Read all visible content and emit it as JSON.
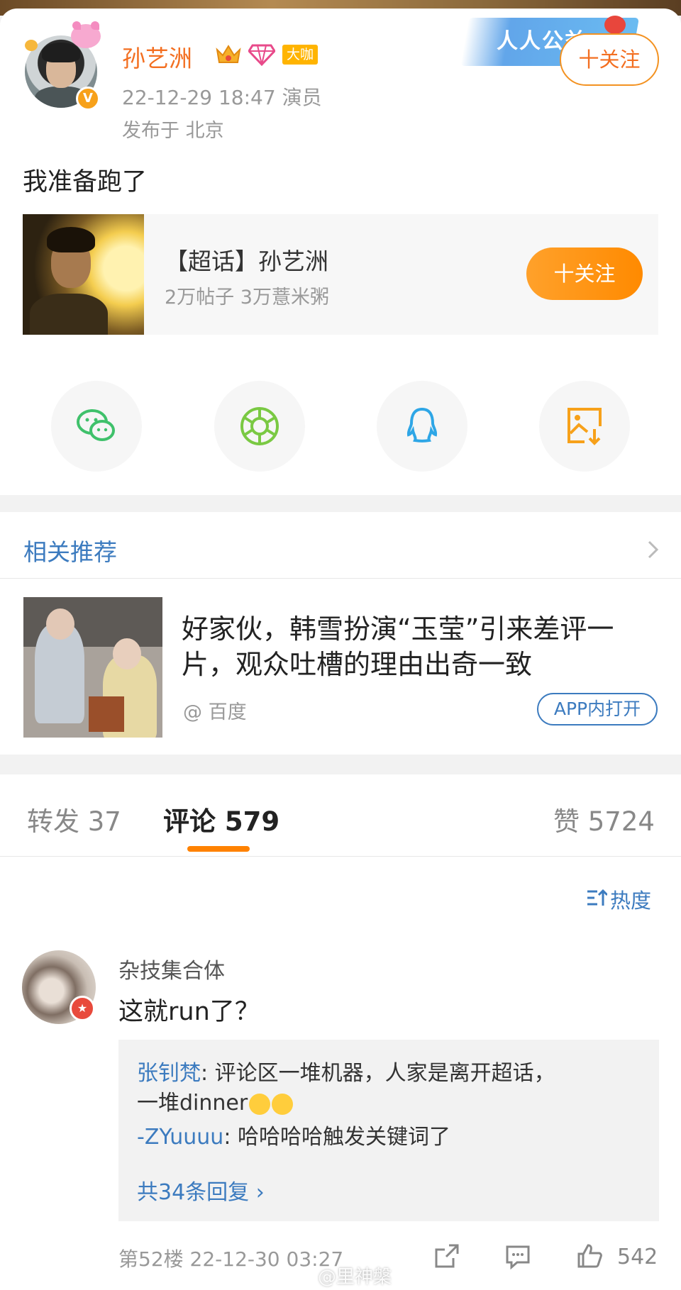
{
  "post": {
    "username": "孙艺洲",
    "badge_label": "大咖",
    "time_role": "22-12-29 18:47  演员",
    "location": "发布于 北京",
    "follow_label": "十关注",
    "banner_text": "人人公益",
    "body": "我准备跑了"
  },
  "topic": {
    "title": "【超话】孙艺洲",
    "stats": "2万帖子 3万薏米粥",
    "follow_label": "十关注"
  },
  "share": {
    "items": [
      "wechat-icon",
      "moments-icon",
      "qq-icon",
      "save-image-icon"
    ],
    "colors": {
      "wechat": "#3fc16b",
      "moments": "#7ac943",
      "qq": "#2ea6e6",
      "save": "#f7a11a"
    }
  },
  "related": {
    "title": "相关推荐",
    "news_title": "好家伙，韩雪扮演“玉莹”引来差评一片，观众吐槽的理由出奇一致",
    "source": "@ 百度",
    "open_label": "APP内打开"
  },
  "tabs": {
    "repost": "转发 37",
    "comment": "评论 579",
    "like": "赞 5724"
  },
  "sort": {
    "label": "热度"
  },
  "comment": {
    "author": "杂技集合体",
    "text": "这就run了？",
    "replies": [
      {
        "user": "张钊梵",
        "text": ": 评论区一堆机器，人家是离开超话，",
        "text2": "一堆dinner"
      },
      {
        "user": "-ZYuuuu",
        "text": ": 哈哈哈哈触发关键词了"
      }
    ],
    "more_replies": "共34条回复 ›",
    "meta": "第52楼  22-12-30 03:27",
    "likes": "542"
  },
  "watermark": "@里神槃",
  "colors": {
    "accent_orange": "#ff8200",
    "link_blue": "#3c7bbf",
    "username_orange": "#f36f21"
  }
}
